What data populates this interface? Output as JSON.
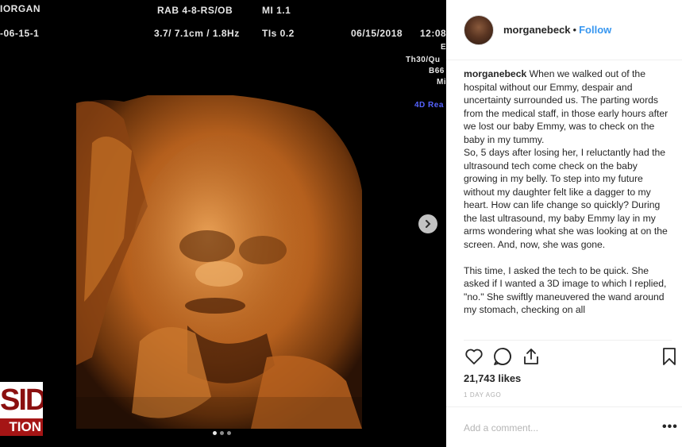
{
  "ultrasound": {
    "patient": "IORGAN",
    "probe": "RAB 4-8-RS/OB",
    "mi": "MI  1.1",
    "id": "-06-15-1",
    "freq": "3.7/ 7.1cm / 1.8Hz",
    "tis": "TIs  0.2",
    "date": "06/15/2018",
    "time": "12:08",
    "side_e": "E",
    "side_th": "Th30/Qu",
    "side_b": "B66",
    "side_mi": "Mi",
    "mode": "4D Rea"
  },
  "watermark": {
    "top": "SIDE",
    "bottom": "TION"
  },
  "post": {
    "username": "morganebeck",
    "separator": "•",
    "follow_label": "Follow",
    "caption_user": "morganebeck",
    "caption_p1": "When we walked out of the hospital without our Emmy, despair and uncertainty surrounded us. The parting words from the medical staff, in those early hours after we lost our baby Emmy, was to check on the baby in my tummy.",
    "caption_p2": "So, 5 days after losing her, I reluctantly had the ultrasound tech come check on the baby growing in my belly. To step into my future without my daughter felt like a dagger to my heart. How can life change so quickly? During the last ultrasound, my baby Emmy lay in my arms wondering what she was looking at on the screen. And, now, she was gone.",
    "caption_p3": "This time, I asked the tech to be quick. She asked if I wanted a 3D image to which I replied, \"no.\" She swiftly maneuvered the wand around my stomach, checking on all",
    "likes": "21,743 likes",
    "timestamp": "1 DAY AGO",
    "comment_placeholder": "Add a comment...",
    "more_label": "•••"
  },
  "icons": {
    "heart": "heart-icon",
    "comment": "comment-icon",
    "share": "share-icon",
    "bookmark": "bookmark-icon",
    "next": "chevron-right-icon"
  },
  "colors": {
    "follow": "#3897f0",
    "scan": "#c06a22"
  }
}
